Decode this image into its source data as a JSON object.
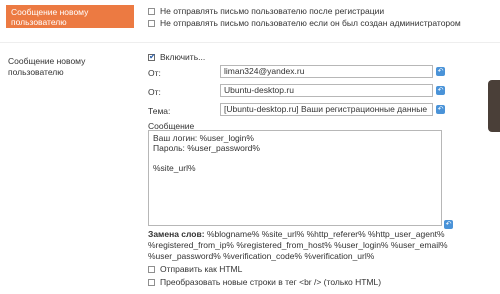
{
  "section": {
    "title": "Сообщение новому пользователю"
  },
  "top_options": [
    {
      "label": "Не отправлять письмо пользователю после регистрации",
      "checked": false
    },
    {
      "label": "Не отправлять письмо пользователю если он был создан администратором",
      "checked": false
    }
  ],
  "message_block": {
    "title": "Сообщение новому пользователю",
    "enable_label": "Включить...",
    "enable_checked": true,
    "from_email_label": "От:",
    "from_email_value": "liman324@yandex.ru",
    "from_name_label": "От:",
    "from_name_value": "Ubuntu-desktop.ru",
    "subject_label": "Тема:",
    "subject_value": "[Ubuntu-desktop.ru] Ваши регистрационные данные",
    "message_label": "Сообщение",
    "message_value": "Ваш логин: %user_login%\nПароль: %user_password%\n\n%site_url%",
    "replace_label": "Замена слов:",
    "replace_line1": "%blogname% %site_url% %http_referer% %http_user_agent%",
    "replace_line2": "%registered_from_ip% %registered_from_host% %user_login% %user_email%",
    "replace_line3": "%user_password% %verification_code% %verification_url%",
    "html_label": "Отправить как HTML",
    "html_checked": false,
    "br_label": "Преобразовать новые строки в тег <br /> (только HTML)",
    "br_checked": false
  },
  "icons": {
    "reset": "reset-arrow-icon"
  }
}
